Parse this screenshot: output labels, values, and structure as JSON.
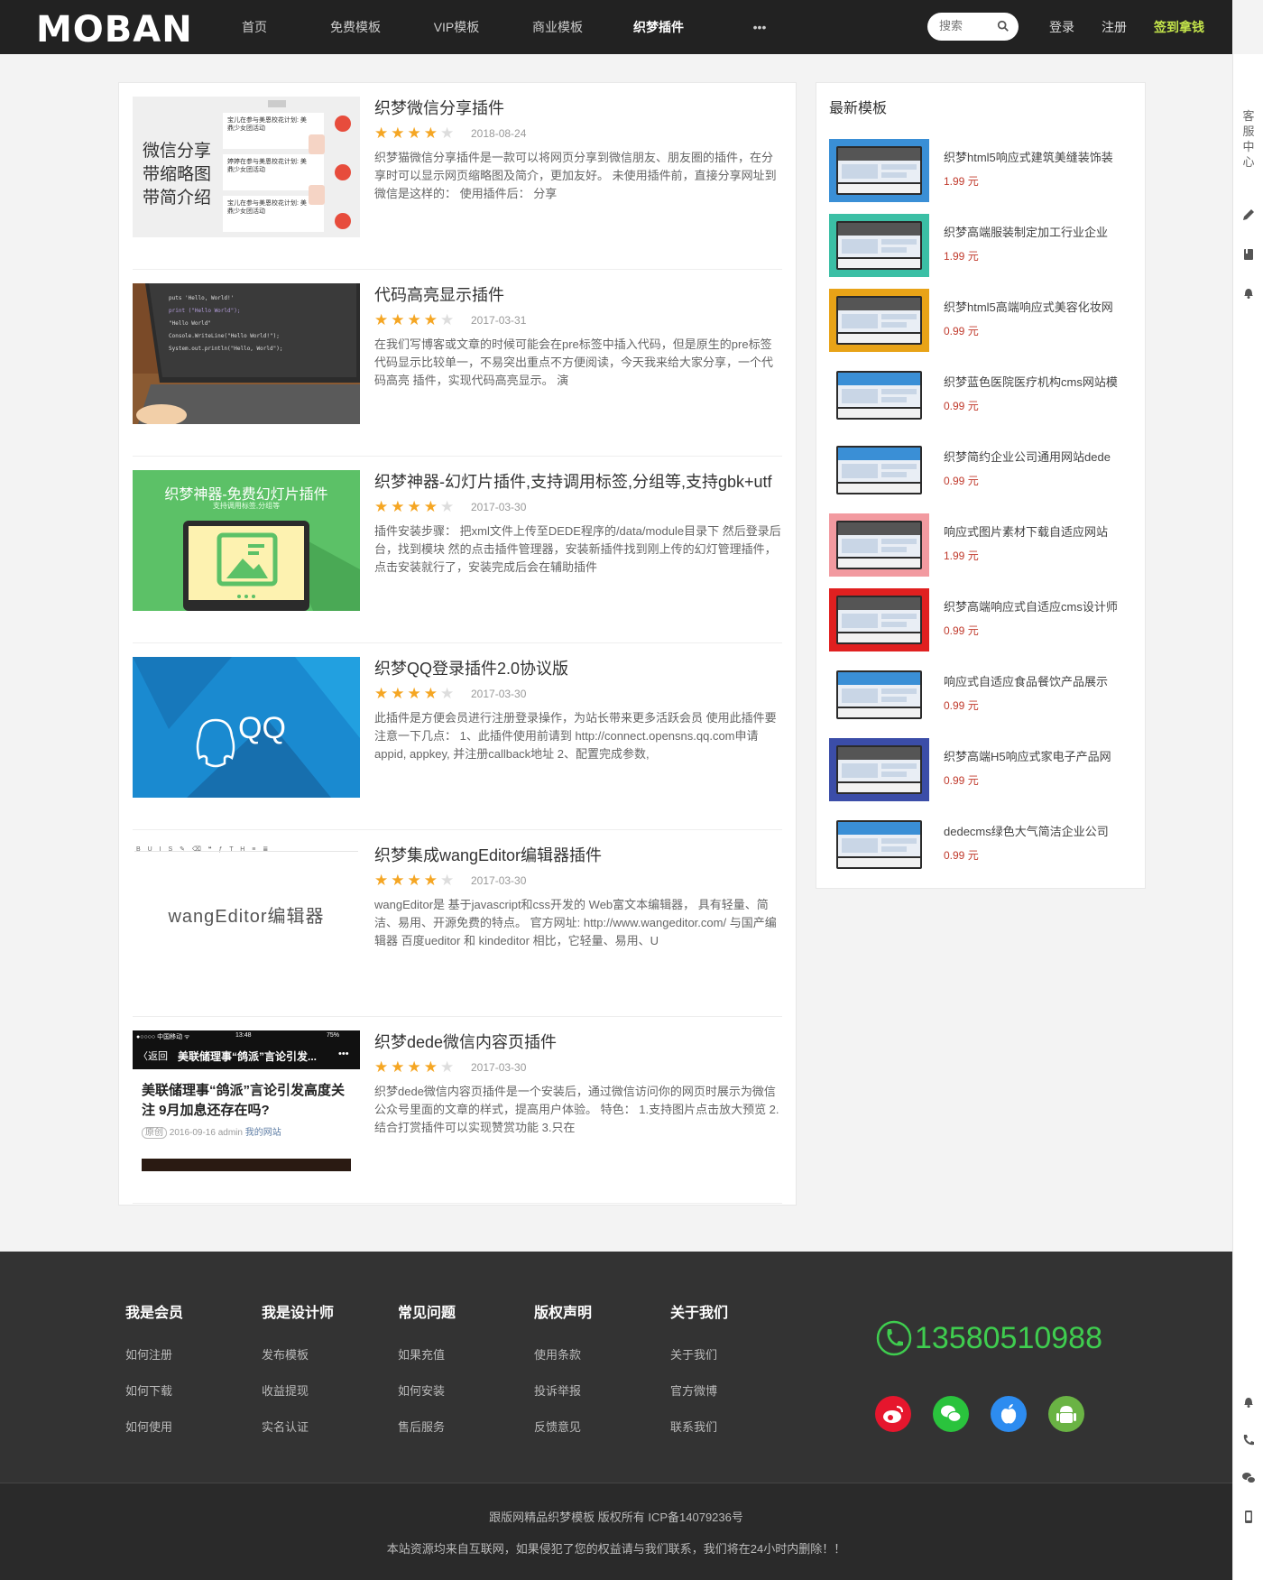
{
  "header": {
    "logo": "MOBAN",
    "nav": [
      "首页",
      "免费模板",
      "VIP模板",
      "商业模板",
      "织梦插件",
      "•••"
    ],
    "active_nav": 4,
    "search_placeholder": "搜索",
    "login": "登录",
    "register": "注册",
    "signin": "签到拿钱"
  },
  "float_bar": {
    "label": "客服中心"
  },
  "items": [
    {
      "title": "织梦微信分享插件",
      "rating": 4,
      "date": "2018-08-24",
      "desc": "织梦猫微信分享插件是一款可以将网页分享到微信朋友、朋友圈的插件，在分享时可以显示网页缩略图及简介，更加友好。 未使用插件前，直接分享网址到微信是这样的： 使用插件后： 分享",
      "thumb": {
        "caption_lines": [
          "微信分享",
          "带缩略图",
          "带简介绍"
        ],
        "chat_lines": [
          "宝儿在参与美恩校花计划: 美鼎少女团活动",
          "婷婷在参与美恩校花计划: 美鼎少女团活动",
          "宝儿在参与美恩校花计划: 美鼎少女团活动"
        ]
      }
    },
    {
      "title": "代码高亮显示插件",
      "rating": 4,
      "date": "2017-03-31",
      "desc": "在我们写博客或文章的时候可能会在pre标签中插入代码，但是原生的pre标签代码显示比较单一，不易突出重点不方便阅读，今天我来给大家分享，一个代码高亮 插件，实现代码高亮显示。 演",
      "thumb": {
        "code_lines": [
          "puts 'Hello, World!'",
          "print (\"Hello World\");",
          "\"Hello World\"",
          "Console.WriteLine(\"Hello World!\");",
          "System.out.println(\"Hello, World\");"
        ]
      }
    },
    {
      "title": "织梦神器-幻灯片插件,支持调用标签,分组等,支持gbk+utf",
      "rating": 4,
      "date": "2017-03-30",
      "desc": "插件安装步骤： 把xml文件上传至DEDE程序的/data/module目录下 然后登录后台，找到模块 然的点击插件管理器，安装新插件找到刚上传的幻灯管理插件，点击安装就行了，安装完成后会在辅助插件",
      "thumb": {
        "heading": "织梦神器-免费幻灯片插件",
        "sub": "支持调用标签,分组等"
      }
    },
    {
      "title": "织梦QQ登录插件2.0协议版",
      "rating": 4,
      "date": "2017-03-30",
      "desc": "此插件是方便会员进行注册登录操作，为站长带来更多活跃会员 使用此插件要注意一下几点： 1、此插件使用前请到 http://connect.opensns.qq.com申请appid, appkey, 并注册callback地址 2、配置完成参数,",
      "thumb": {
        "label": "QQ"
      }
    },
    {
      "title": "织梦集成wangEditor编辑器插件",
      "rating": 4,
      "date": "2017-03-30",
      "desc": "wangEditor是 基于javascript和css开发的 Web富文本编辑器， 具有轻量、简洁、易用、开源免费的特点。 官方网址: http://www.wangeditor.com/ 与国产编辑器 百度ueditor 和 kindeditor 相比，它轻量、易用、U",
      "thumb": {
        "label": "wangEditor编辑器",
        "toolbar": "B  U  I  S  ✎  ⌫   ❝  ƒ  T  H  ≡  ≣"
      }
    },
    {
      "title": "织梦dede微信内容页插件",
      "rating": 4,
      "date": "2017-03-30",
      "desc": "织梦dede微信内容页插件是一个安装后，通过微信访问你的网页时展示为微信公众号里面的文章的样式，提高用户体验。 特色： 1.支持图片点击放大预览 2.结合打赏插件可以实现赞赏功能 3.只在",
      "thumb": {
        "status_left": "●○○○○ 中国移动 ᯤ",
        "status_time": "13:48",
        "status_right": "75%",
        "back": "〈返回",
        "nav_title": "美联储理事“鸽派”言论引发...",
        "nav_more": "•••",
        "article": "美联储理事“鸽派”言论引发高度关注 9月加息还存在吗?",
        "meta_tag": "原创",
        "meta_info": "2016-09-16 admin",
        "meta_site": "我的网站"
      }
    }
  ],
  "sidebar": {
    "title": "最新模板",
    "items": [
      {
        "name": "织梦html5响应式建筑美缝装饰装",
        "price": "1.99 元",
        "color": "#3a8fd6"
      },
      {
        "name": "织梦高端服装制定加工行业企业",
        "price": "1.99 元",
        "color": "#3bbfa5"
      },
      {
        "name": "织梦html5高端响应式美容化妆网",
        "price": "0.99 元",
        "color": "#e8a317"
      },
      {
        "name": "织梦蓝色医院医疗机构cms网站模",
        "price": "0.99 元",
        "color": "#ffffff"
      },
      {
        "name": "织梦简约企业公司通用网站dede",
        "price": "0.99 元",
        "color": "#ffffff"
      },
      {
        "name": "响应式图片素材下载自适应网站",
        "price": "1.99 元",
        "color": "#f29aa0"
      },
      {
        "name": "织梦高端响应式自适应cms设计师",
        "price": "0.99 元",
        "color": "#e02020"
      },
      {
        "name": "响应式自适应食品餐饮产品展示",
        "price": "0.99 元",
        "color": "#ffffff"
      },
      {
        "name": "织梦高端H5响应式家电子产品网",
        "price": "0.99 元",
        "color": "#3b4da8"
      },
      {
        "name": "dedecms绿色大气简洁企业公司",
        "price": "0.99 元",
        "color": "#ffffff"
      }
    ]
  },
  "footer": {
    "columns": [
      {
        "title": "我是会员",
        "links": [
          "如何注册",
          "如何下载",
          "如何使用"
        ]
      },
      {
        "title": "我是设计师",
        "links": [
          "发布模板",
          "收益提现",
          "实名认证"
        ]
      },
      {
        "title": "常见问题",
        "links": [
          "如果充值",
          "如何安装",
          "售后服务"
        ]
      },
      {
        "title": "版权声明",
        "links": [
          "使用条款",
          "投诉举报",
          "反馈意见"
        ]
      },
      {
        "title": "关于我们",
        "links": [
          "关于我们",
          "官方微博",
          "联系我们"
        ]
      }
    ],
    "phone": "13580510988",
    "social": [
      {
        "name": "weibo",
        "color": "#e6162d"
      },
      {
        "name": "wechat",
        "color": "#2ac33d"
      },
      {
        "name": "apple",
        "color": "#2d8cf0"
      },
      {
        "name": "android",
        "color": "#6ab344"
      }
    ],
    "copyright": "跟版网精品织梦模板 版权所有 ICP备14079236号",
    "disclaimer": "本站资源均来自互联网，如果侵犯了您的权益请与我们联系，我们将在24小时内删除！！"
  }
}
